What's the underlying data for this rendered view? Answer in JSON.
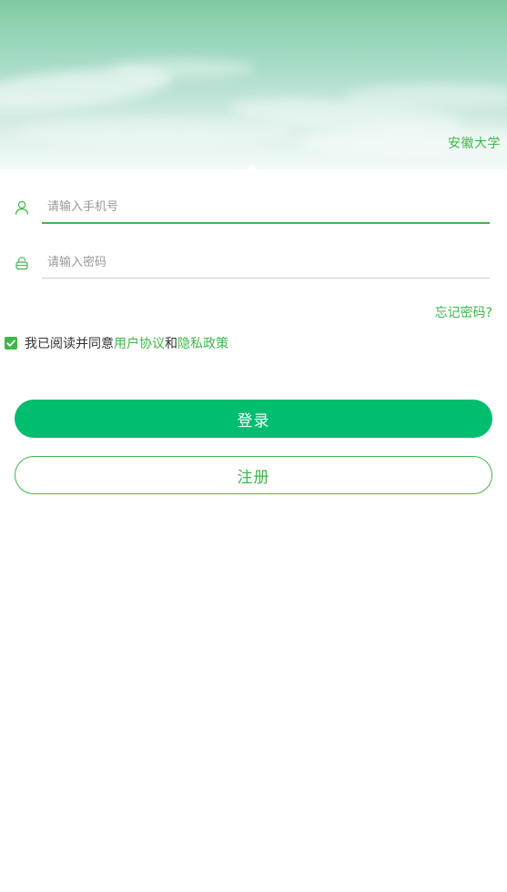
{
  "banner": {
    "title": "安徽大学"
  },
  "form": {
    "phone_placeholder": "请输入手机号",
    "password_placeholder": "请输入密码",
    "phone_icon": "user-icon",
    "password_icon": "lock-icon"
  },
  "forgot": {
    "label": "忘记密码?"
  },
  "agreement": {
    "checked": true,
    "prefix": "我已阅读并同意",
    "user_agreement": "用户协议",
    "conjunction": "和",
    "privacy_policy": "隐私政策"
  },
  "buttons": {
    "login": "登录",
    "register": "注册"
  },
  "colors": {
    "accent": "#3cb84a",
    "primary_button": "#00bd6f"
  }
}
